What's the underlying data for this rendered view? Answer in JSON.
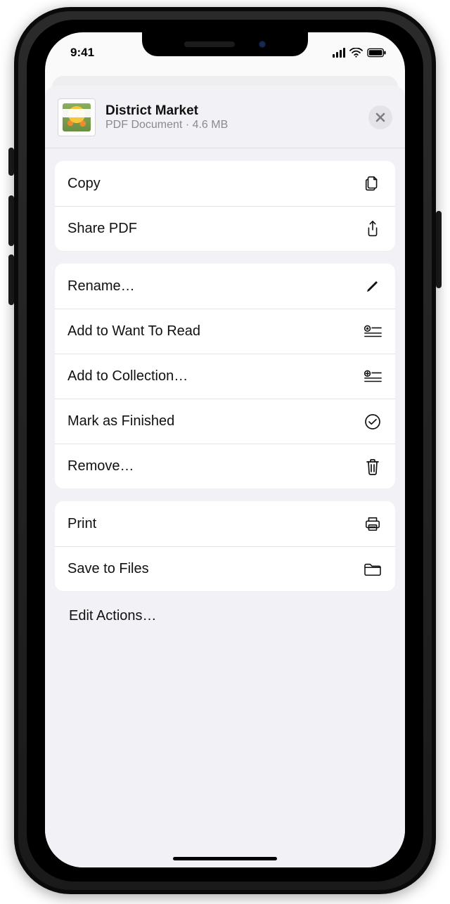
{
  "status": {
    "time": "9:41"
  },
  "header": {
    "title": "District Market",
    "subtitle": "PDF Document · 4.6 MB"
  },
  "groups": [
    {
      "rows": [
        {
          "key": "copy",
          "label": "Copy"
        },
        {
          "key": "share_pdf",
          "label": "Share PDF"
        }
      ]
    },
    {
      "rows": [
        {
          "key": "rename",
          "label": "Rename…"
        },
        {
          "key": "add_want_read",
          "label": "Add to Want To Read"
        },
        {
          "key": "add_collection",
          "label": "Add to Collection…"
        },
        {
          "key": "mark_finished",
          "label": "Mark as Finished"
        },
        {
          "key": "remove",
          "label": "Remove…"
        }
      ]
    },
    {
      "rows": [
        {
          "key": "print",
          "label": "Print"
        },
        {
          "key": "save_to_files",
          "label": "Save to Files"
        }
      ]
    }
  ],
  "edit_actions": "Edit Actions…"
}
